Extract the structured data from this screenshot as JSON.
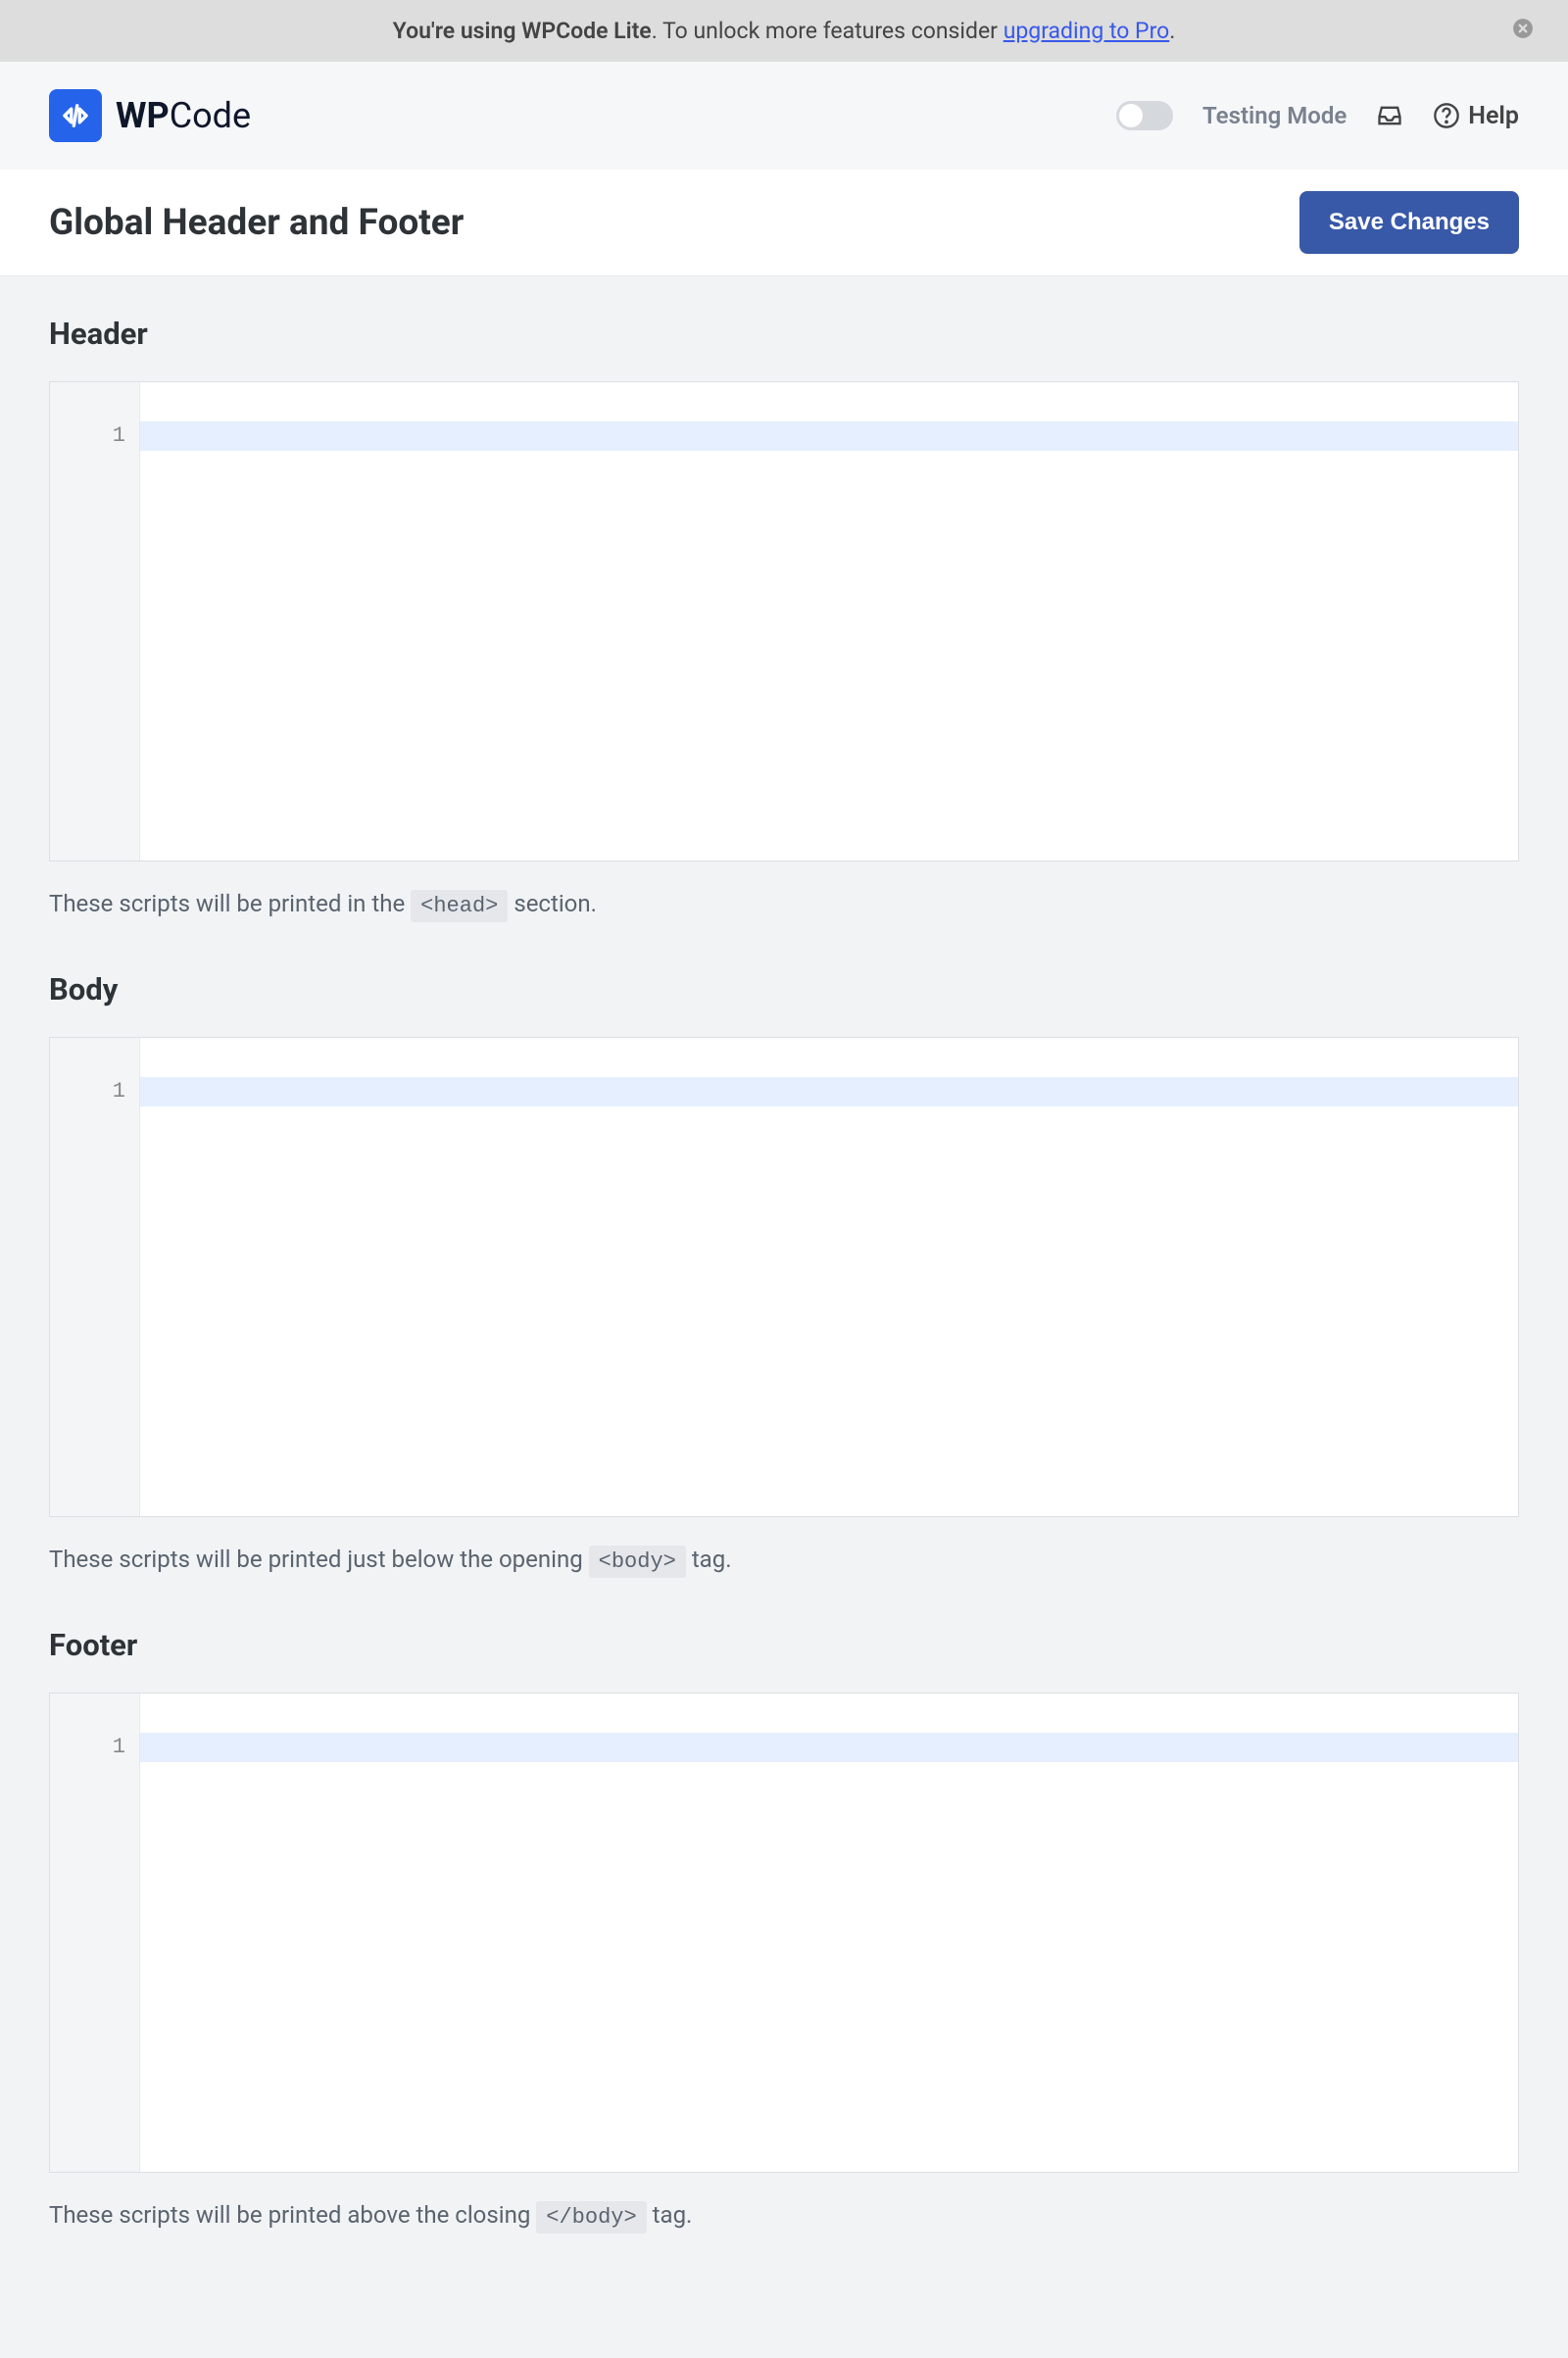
{
  "promo": {
    "prefix_bold": "You're using WPCode Lite",
    "middle": ". To unlock more features consider ",
    "link": "upgrading to Pro",
    "suffix": "."
  },
  "brand": {
    "bold": "WP",
    "rest": "Code"
  },
  "topbar": {
    "testing_mode": "Testing Mode",
    "help": "Help"
  },
  "page_title": "Global Header and Footer",
  "save_button": "Save Changes",
  "sections": {
    "header": {
      "title": "Header",
      "line": "1",
      "hint_before": "These scripts will be printed in the ",
      "hint_code": "<head>",
      "hint_after": " section."
    },
    "body": {
      "title": "Body",
      "line": "1",
      "hint_before": "These scripts will be printed just below the opening ",
      "hint_code": "<body>",
      "hint_after": " tag."
    },
    "footer": {
      "title": "Footer",
      "line": "1",
      "hint_before": "These scripts will be printed above the closing ",
      "hint_code": "</body>",
      "hint_after": " tag."
    }
  }
}
